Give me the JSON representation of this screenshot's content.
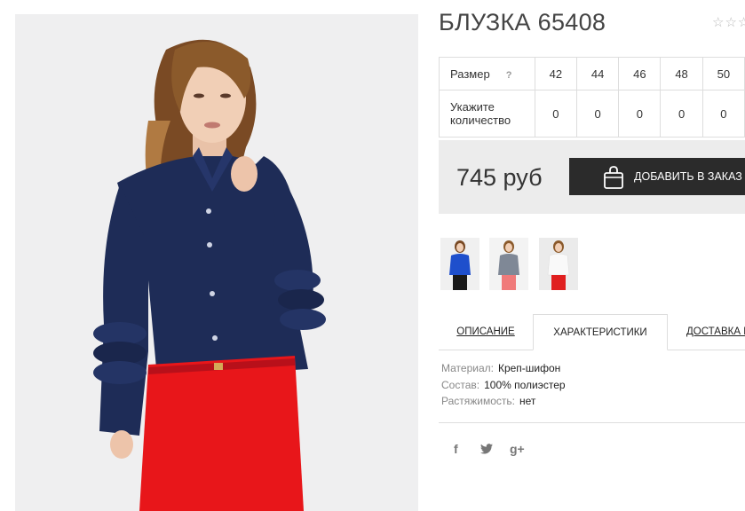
{
  "product": {
    "title": "БЛУЗКА 65408",
    "rating_stars": "☆☆☆"
  },
  "size_table": {
    "size_label": "Размер",
    "help_icon": "?",
    "sizes": [
      "42",
      "44",
      "46",
      "48",
      "50"
    ],
    "qty_label": "Укажите количество",
    "quantities": [
      "0",
      "0",
      "0",
      "0",
      "0"
    ]
  },
  "price": {
    "value": "745 руб",
    "button_label": "ДОБАВИТЬ В ЗАКАЗ",
    "button_icon": "shopping-bag-icon"
  },
  "thumbnails": [
    {
      "name": "blue-blouse",
      "shirt_color": "#1e4fcc",
      "pants_color": "#1a1a1a"
    },
    {
      "name": "gray-blouse",
      "shirt_color": "#7f8896",
      "pants_color": "#f07a7a"
    },
    {
      "name": "white-blouse",
      "shirt_color": "#f4f4f4",
      "pants_color": "#e01f1f"
    }
  ],
  "tabs": {
    "description": "ОПИСАНИЕ",
    "characteristics": "ХАРАКТЕРИСТИКИ",
    "delivery": "ДОСТАВКА И"
  },
  "specs": [
    {
      "key": "Материал:",
      "value": "Креп-шифон"
    },
    {
      "key": "Состав:",
      "value": "100% полиэстер"
    },
    {
      "key": "Растяжимость:",
      "value": "нет"
    }
  ],
  "social": {
    "facebook": "f",
    "twitter": "🐦",
    "googleplus": "g+"
  },
  "colors": {
    "blouse": "#1e2c57",
    "pants": "#e8161a",
    "button_bg": "#2b2b2b",
    "price_bg": "#ececec"
  }
}
